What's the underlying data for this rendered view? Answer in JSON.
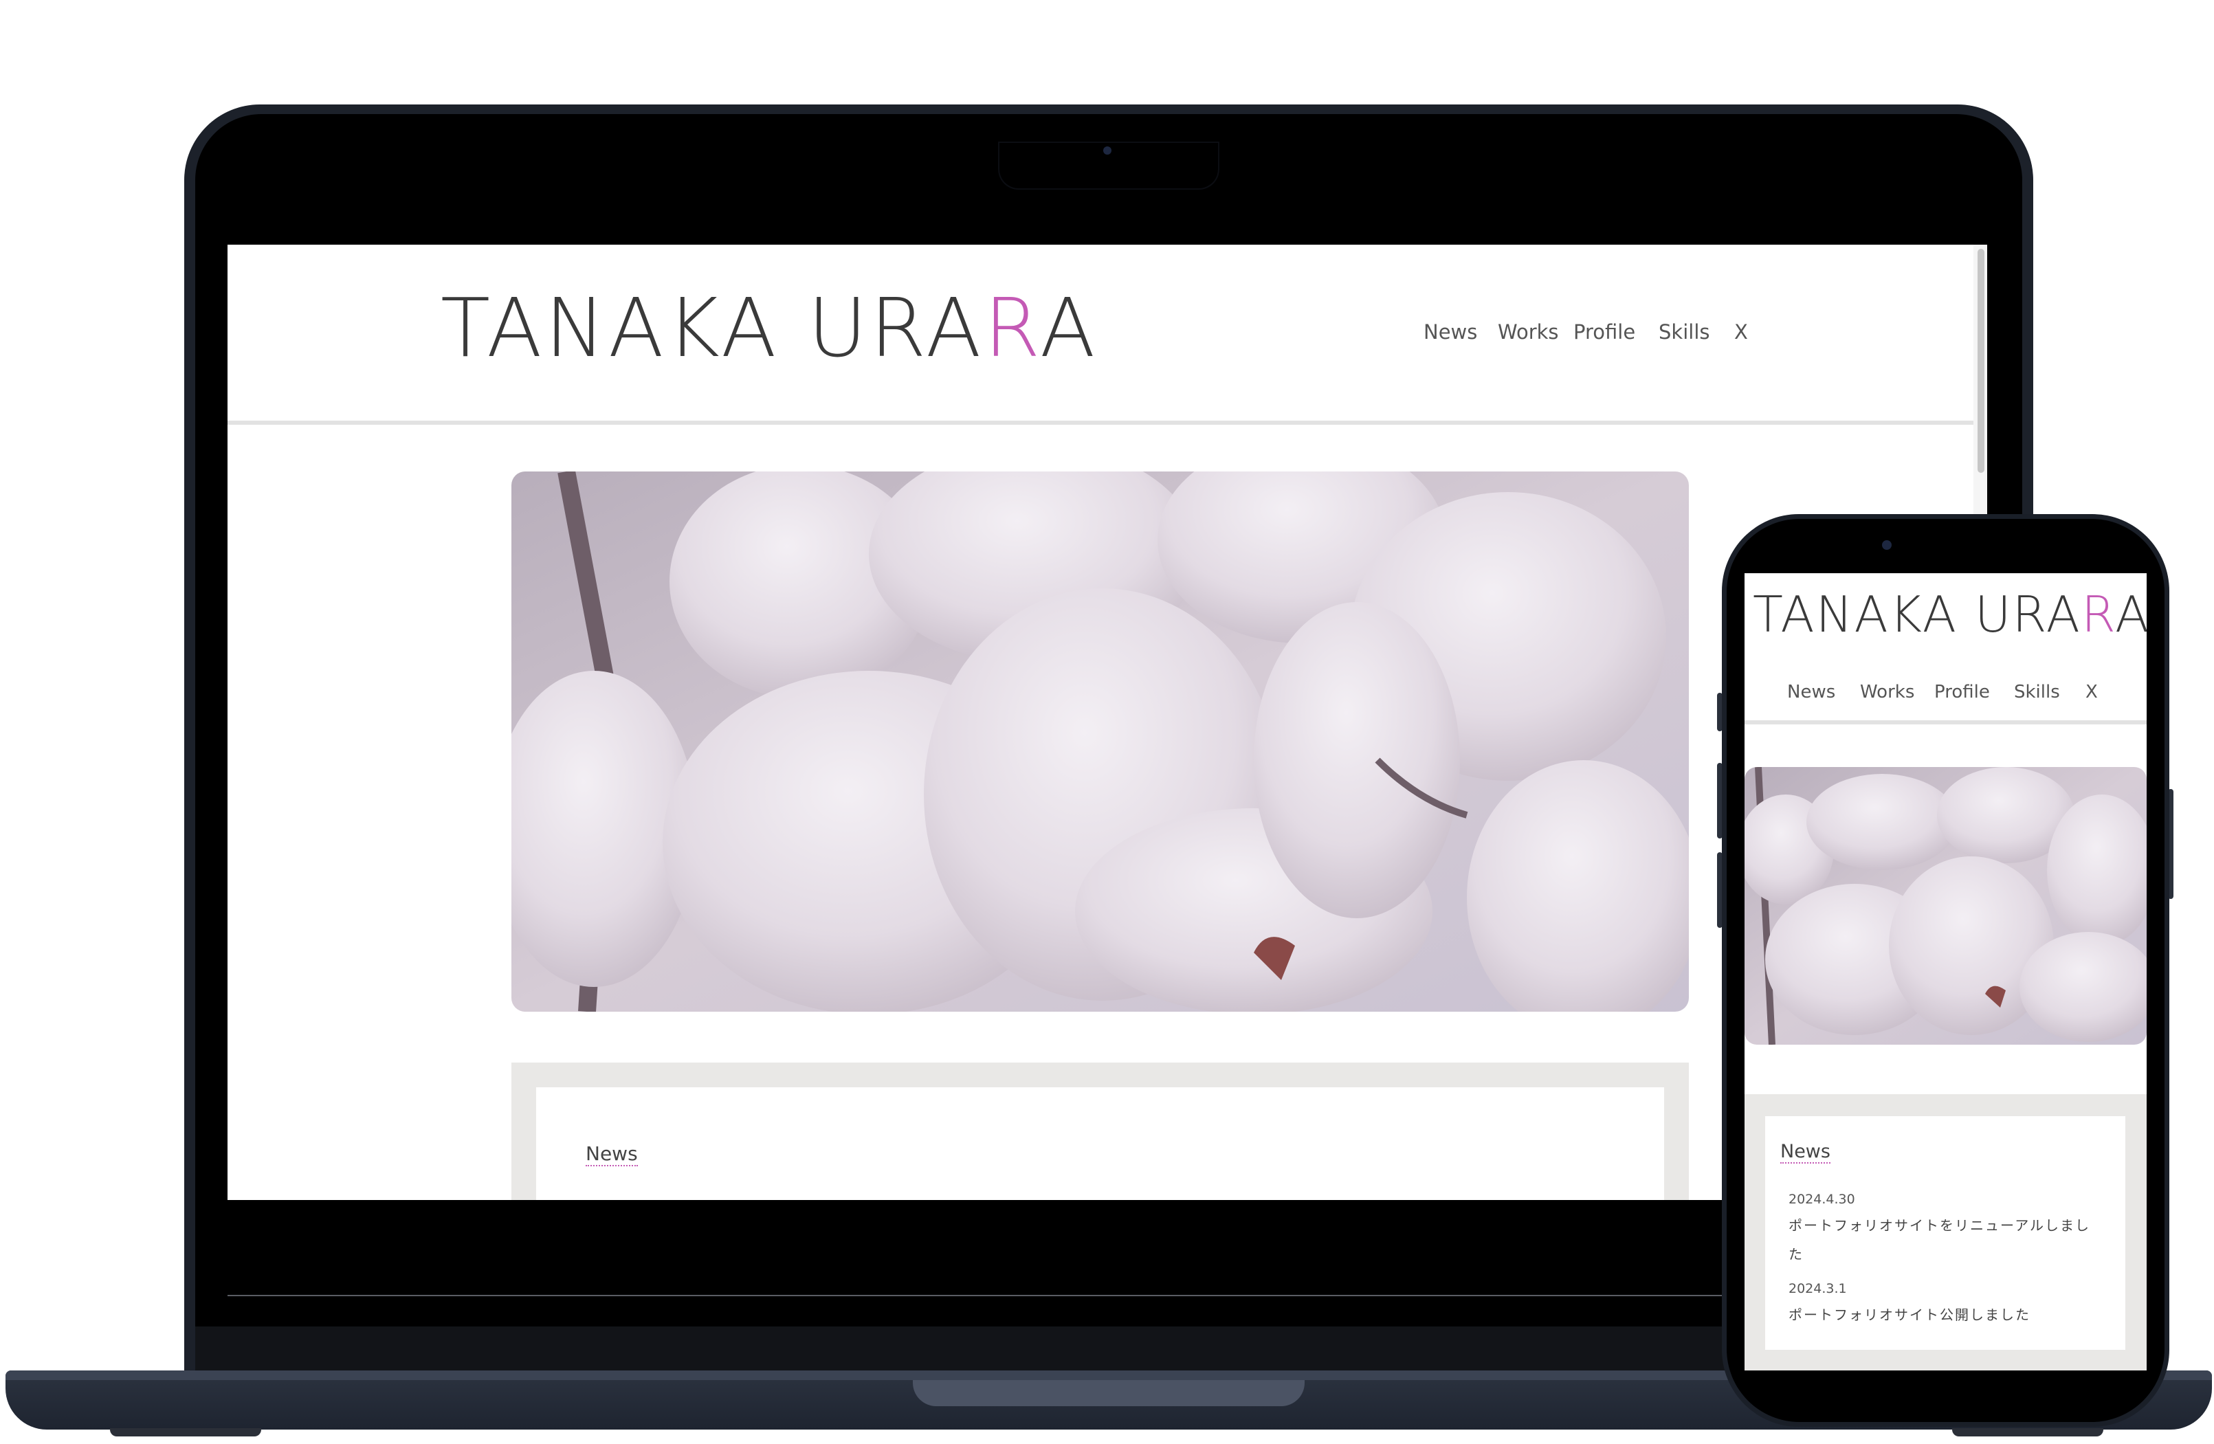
{
  "site": {
    "logo_main": "TANAKA URA",
    "logo_accent": "R",
    "logo_tail": "A",
    "nav": [
      {
        "label": "News"
      },
      {
        "label": "Works"
      },
      {
        "label": "Profile"
      },
      {
        "label": "Skills"
      },
      {
        "label": "X"
      }
    ],
    "news_title": "News",
    "news_items": [
      {
        "date": "2024.4.30",
        "text": "ポートフォリオサイトをリニューアルしました"
      },
      {
        "date": "2024.3.1",
        "text": "ポートフォリオサイト公開しました"
      }
    ]
  },
  "colors": {
    "accent": "#c45ab5",
    "text": "#3a3a3a",
    "news_panel_bg": "#e9e8e6",
    "device_frame": "#1c212a"
  },
  "images": {
    "hero": "magnolia-flowers-photo"
  }
}
